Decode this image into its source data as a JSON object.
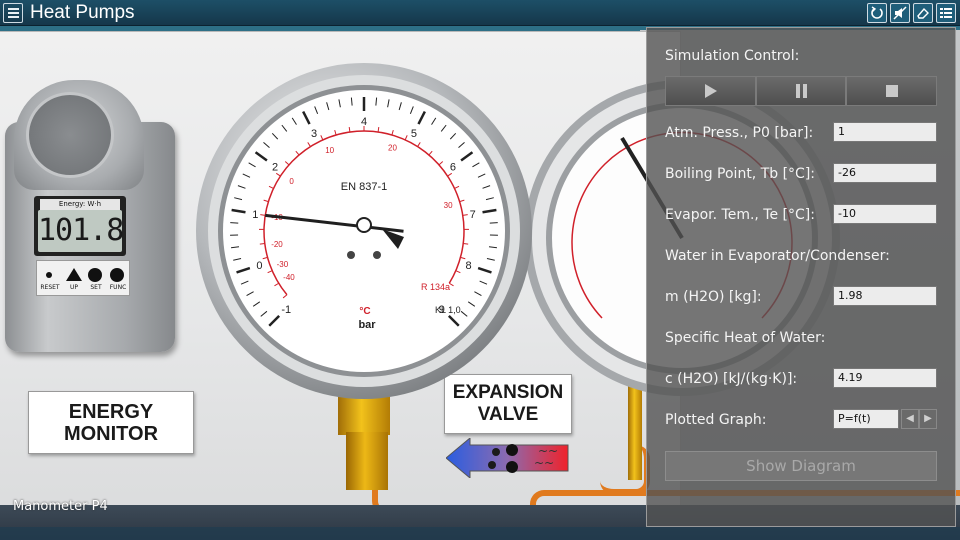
{
  "app": {
    "title": "Heat Pumps"
  },
  "toolbar": {
    "icons": [
      "reset-icon",
      "mute-icon",
      "eraser-icon",
      "settings-list-icon"
    ]
  },
  "energy_monitor": {
    "screen_label": "Energy: W·h",
    "reading": "101.8",
    "keys": [
      "RESET",
      "UP",
      "SET",
      "FUNC"
    ],
    "card": [
      "ENERGY",
      "MONITOR"
    ]
  },
  "expansion_valve": {
    "card": [
      "EXPANSION",
      "VALVE"
    ]
  },
  "gauge": {
    "standard": "EN 837-1",
    "unit_temp": "°C",
    "unit_pressure": "bar",
    "refrigerant": "R 134a",
    "class": "KL 1,0",
    "bar_ticks": [
      "-1",
      "0",
      "1",
      "2",
      "3",
      "4",
      "5",
      "6",
      "7",
      "8",
      "9"
    ],
    "temp_ticks": [
      "-40",
      "-30",
      "-20",
      "-10",
      "0",
      "10",
      "20",
      "30"
    ],
    "needle_value_bar": 1.0
  },
  "status": {
    "label": "Manometer P4"
  },
  "panel": {
    "title": "Simulation Control:",
    "fields": {
      "atm_press_label": "Atm. Press., P0 [bar]:",
      "atm_press_value": "1",
      "boiling_label": "Boiling Point, Tb [°C]:",
      "boiling_value": "-26",
      "evapor_label": "Evapor. Tem., Te [°C]:",
      "evapor_value": "-10",
      "water_header": "Water in Evaporator/Condenser:",
      "mass_label": "m (H2O) [kg]:",
      "mass_value": "1.98",
      "specific_header": "Specific Heat of Water:",
      "c_label": "c (H2O) [kJ/(kg·K)]:",
      "c_value": "4.19",
      "plotted_label": "Plotted Graph:",
      "plotted_value": "P=f(t)"
    },
    "show_diagram": "Show Diagram"
  },
  "colors": {
    "topbar": "#1d4f67",
    "panel": "#525252",
    "pipe": "#e07a1e",
    "gauge_red": "#d0202a",
    "brass": "#f2c21b"
  }
}
